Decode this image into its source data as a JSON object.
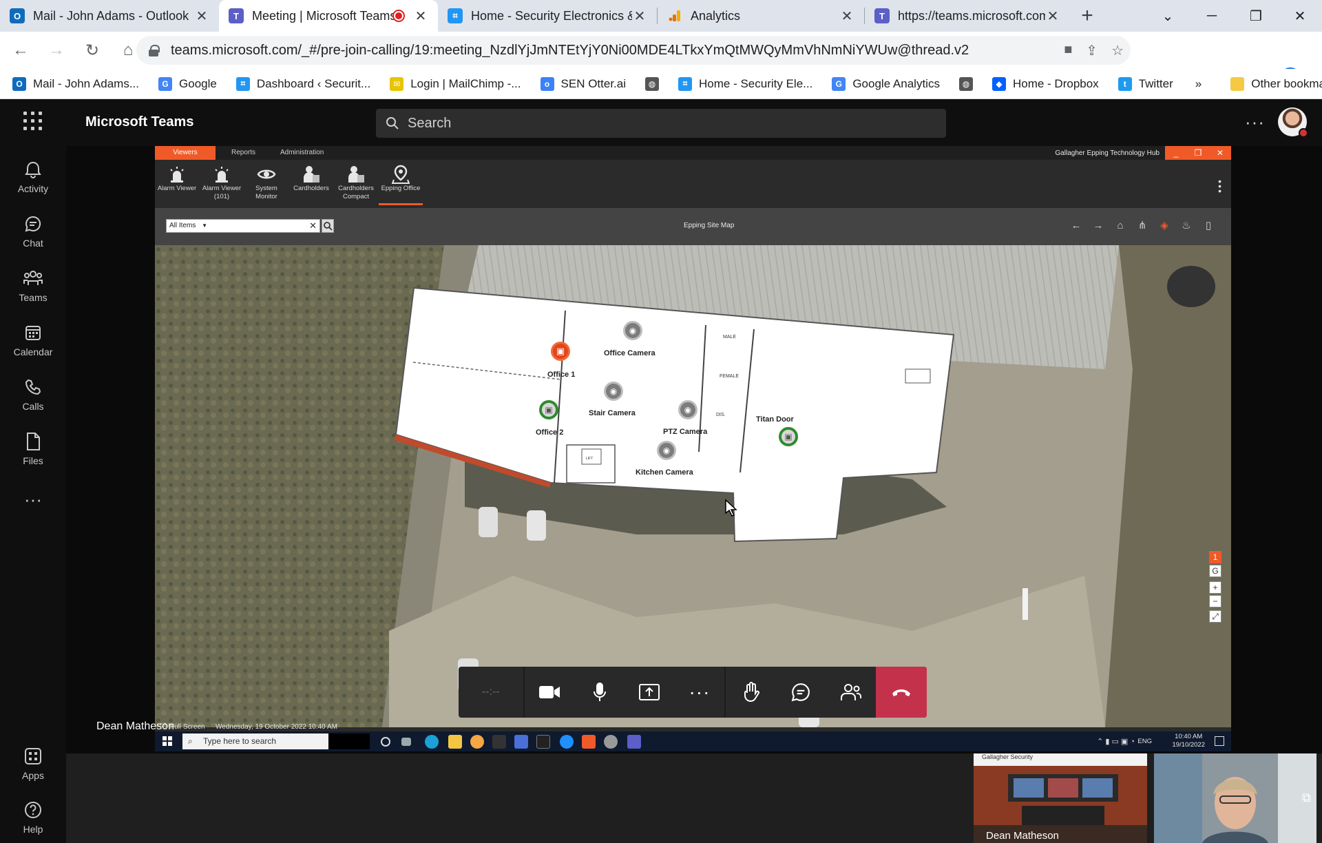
{
  "browser": {
    "tabs": [
      {
        "title": "Mail - John Adams - Outlook",
        "icon": "outlook-icon",
        "color": "#0f6cbd",
        "active": false
      },
      {
        "title": "Meeting | Microsoft Teams",
        "icon": "teams-icon",
        "color": "#5b5fc7",
        "active": true,
        "recording": true
      },
      {
        "title": "Home - Security Electronics &",
        "icon": "page-icon",
        "color": "#2196f3",
        "active": false
      },
      {
        "title": "Analytics",
        "icon": "analytics-icon",
        "color": "#f9ab00",
        "active": false
      },
      {
        "title": "https://teams.microsoft.com/",
        "icon": "teams-icon",
        "color": "#5b5fc7",
        "active": false
      }
    ],
    "url": "teams.microsoft.com/_#/pre-join-calling/19:meeting_NzdlYjJmNTEtYjY0Ni00MDE4LTkxYmQtMWQyMmVhNmNiYWUw@thread.v2",
    "bookmarks": [
      {
        "label": "Mail - John Adams...",
        "color": "#0f6cbd",
        "glyph": "O"
      },
      {
        "label": "Google",
        "color": "#4285f4",
        "glyph": "G"
      },
      {
        "label": "Dashboard ‹ Securit...",
        "color": "#2196f3",
        "glyph": "⌗"
      },
      {
        "label": "Login | MailChimp -...",
        "color": "#e8c400",
        "glyph": "✉"
      },
      {
        "label": "SEN Otter.ai",
        "color": "#3b82f6",
        "glyph": "o"
      },
      {
        "label": "",
        "color": "#555555",
        "glyph": "◍"
      },
      {
        "label": "Home - Security Ele...",
        "color": "#2196f3",
        "glyph": "⌗"
      },
      {
        "label": "Google Analytics",
        "color": "#4285f4",
        "glyph": "G"
      },
      {
        "label": "",
        "color": "#555555",
        "glyph": "◍"
      },
      {
        "label": "Home - Dropbox",
        "color": "#0061fe",
        "glyph": "◆"
      },
      {
        "label": "Twitter",
        "color": "#1d9bf0",
        "glyph": "t"
      }
    ],
    "bookmarks_overflow": "»",
    "other_bookmarks": "Other bookmarks"
  },
  "teams": {
    "app_title": "Microsoft Teams",
    "search_placeholder": "Search",
    "rail": [
      {
        "label": "Activity",
        "icon": "bell-icon"
      },
      {
        "label": "Chat",
        "icon": "chat-icon"
      },
      {
        "label": "Teams",
        "icon": "teams-people-icon"
      },
      {
        "label": "Calendar",
        "icon": "calendar-icon"
      },
      {
        "label": "Calls",
        "icon": "phone-icon"
      },
      {
        "label": "Files",
        "icon": "file-icon"
      }
    ],
    "rail_bottom": [
      {
        "label": "Apps",
        "icon": "apps-icon"
      },
      {
        "label": "Help",
        "icon": "help-icon"
      }
    ],
    "presenter_name": "Dean Matheson",
    "call_timer": "--:--",
    "participants": [
      {
        "name": "Dean Matheson",
        "tile_caption": "Gallagher Security"
      },
      {
        "name": ""
      }
    ]
  },
  "gallagher": {
    "tabs": [
      "Viewers",
      "Reports",
      "Administration"
    ],
    "window_title": "Gallagher Epping Technology Hub",
    "ribbon": [
      {
        "label": "Alarm Viewer",
        "icon": "alarm-icon"
      },
      {
        "label": "Alarm Viewer (101)",
        "icon": "alarm-icon"
      },
      {
        "label": "System Monitor",
        "icon": "eye-icon"
      },
      {
        "label": "Cardholders",
        "icon": "cardholders-icon"
      },
      {
        "label": "Cardholders Compact",
        "icon": "cardholders-icon"
      },
      {
        "label": "Epping Office",
        "icon": "map-pin-icon"
      }
    ],
    "filter_value": "All Items",
    "map_title": "Epping Site Map",
    "map_items": [
      {
        "label": "Office Camera",
        "kind": "camera"
      },
      {
        "label": "Office 1",
        "kind": "door-alarm"
      },
      {
        "label": "Stair Camera",
        "kind": "camera"
      },
      {
        "label": "Office 2",
        "kind": "door-ok"
      },
      {
        "label": "PTZ Camera",
        "kind": "camera"
      },
      {
        "label": "Titan Door",
        "kind": "door-ok"
      },
      {
        "label": "Kitchen Camera",
        "kind": "camera"
      }
    ],
    "floor_buttons": [
      "1",
      "G"
    ],
    "status_text": "Full Screen",
    "status_date": "Wednesday, 19 October 2022 10:40 AM",
    "plan_labels": [
      "MALE",
      "FEMALE",
      "DIS.",
      "LIFT"
    ]
  },
  "windows_taskbar": {
    "search_placeholder": "Type here to search",
    "time": "10:40 AM",
    "date": "19/10/2022",
    "lang": "ENG"
  },
  "colors": {
    "gallagher_orange": "#f05a28",
    "teams_red": "#c4314b",
    "alarm_red": "#e2451c",
    "ok_green": "#2e8b2e"
  }
}
